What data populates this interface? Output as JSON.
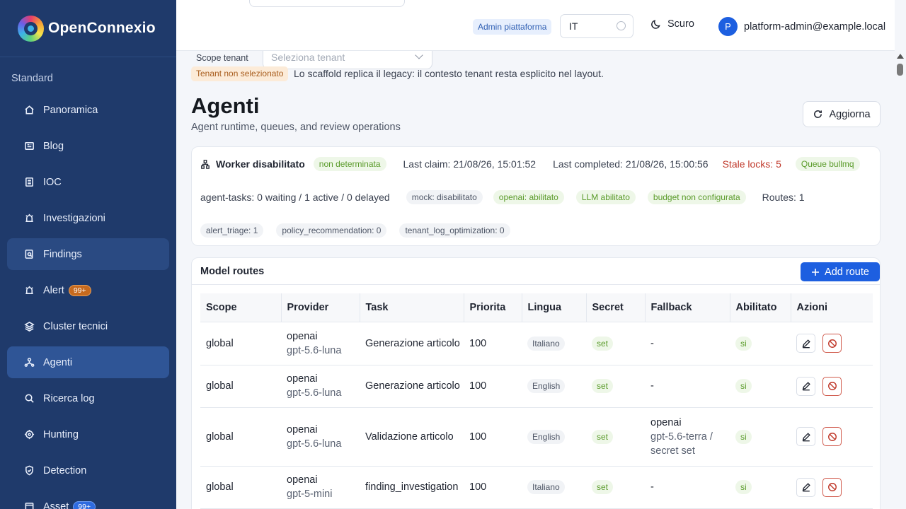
{
  "brand": {
    "name": "OpenConnexio"
  },
  "sidebar": {
    "section": "Standard",
    "items": [
      {
        "label": "Panoramica",
        "icon": "home-icon"
      },
      {
        "label": "Blog",
        "icon": "newspaper-icon"
      },
      {
        "label": "IOC",
        "icon": "document-icon"
      },
      {
        "label": "Investigazioni",
        "icon": "alarm-icon"
      },
      {
        "label": "Findings",
        "icon": "file-search-icon"
      },
      {
        "label": "Alert",
        "icon": "alarm-icon",
        "badge": "99+"
      },
      {
        "label": "Cluster tecnici",
        "icon": "layers-icon"
      },
      {
        "label": "Agenti",
        "icon": "network-icon"
      },
      {
        "label": "Ricerca log",
        "icon": "search-icon"
      },
      {
        "label": "Hunting",
        "icon": "target-icon"
      },
      {
        "label": "Detection",
        "icon": "shield-icon"
      },
      {
        "label": "Asset",
        "icon": "box-icon",
        "badge": "99+"
      }
    ]
  },
  "topbar": {
    "role_badge": "Admin piattaforma",
    "language": "IT",
    "theme_label": "Scuro",
    "user_initial": "P",
    "user_email": "platform-admin@example.local"
  },
  "tenant": {
    "scope_label": "Scope tenant",
    "select_placeholder": "Seleziona tenant",
    "status_badge": "Tenant non selezionato",
    "note": "Lo scaffold replica il legacy: il contesto tenant resta esplicito nel layout."
  },
  "page": {
    "title": "Agenti",
    "subtitle": "Agent runtime, queues, and review operations",
    "refresh_label": "Aggiorna"
  },
  "worker": {
    "title": "Worker disabilitato",
    "status": "non determinata",
    "last_claim": "Last claim: 21/08/26, 15:01:52",
    "last_completed": "Last completed: 21/08/26, 15:00:56",
    "stale_locks": "Stale locks: 5",
    "queue": "Queue bullmq",
    "tasks": "agent-tasks: 0 waiting / 1 active / 0 delayed",
    "mock": "mock: disabilitato",
    "openai": "openai: abilitato",
    "llm": "LLM abilitato",
    "budget": "budget non configurata",
    "routes": "Routes: 1",
    "counters": [
      "alert_triage: 1",
      "policy_recommendation: 0",
      "tenant_log_optimization: 0"
    ]
  },
  "routes": {
    "title": "Model routes",
    "add_label": "Add route",
    "columns": [
      "Scope",
      "Provider",
      "Task",
      "Priorita",
      "Lingua",
      "Secret",
      "Fallback",
      "Abilitato",
      "Azioni"
    ],
    "rows": [
      {
        "scope": "global",
        "provider": "openai",
        "model": "gpt-5.6-luna",
        "task": "Generazione articolo",
        "priority": "100",
        "language": "Italiano",
        "secret": "set",
        "fallback": [
          "-"
        ],
        "enabled": "si"
      },
      {
        "scope": "global",
        "provider": "openai",
        "model": "gpt-5.6-luna",
        "task": "Generazione articolo",
        "priority": "100",
        "language": "English",
        "secret": "set",
        "fallback": [
          "-"
        ],
        "enabled": "si"
      },
      {
        "scope": "global",
        "provider": "openai",
        "model": "gpt-5.6-luna",
        "task": "Validazione articolo",
        "priority": "100",
        "language": "English",
        "secret": "set",
        "fallback": [
          "openai",
          "gpt-5.6-terra /",
          "secret set"
        ],
        "enabled": "si"
      },
      {
        "scope": "global",
        "provider": "openai",
        "model": "gpt-5-mini",
        "task": "finding_investigation",
        "priority": "100",
        "language": "Italiano",
        "secret": "set",
        "fallback": [
          "-"
        ],
        "enabled": "si"
      }
    ]
  }
}
